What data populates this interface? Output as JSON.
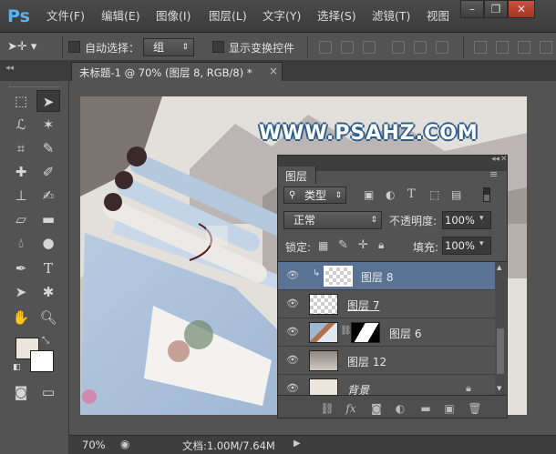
{
  "app": {
    "logo": "Ps"
  },
  "menu": [
    "文件(F)",
    "编辑(E)",
    "图像(I)",
    "图层(L)",
    "文字(Y)",
    "选择(S)",
    "滤镜(T)",
    "视图"
  ],
  "window_buttons": {
    "minimize": "–",
    "restore": "❐",
    "close": "✕"
  },
  "options": {
    "auto_select_label": "自动选择：",
    "auto_select_value": "组",
    "show_transform_label": "显示变换控件"
  },
  "document_tab": {
    "title": "未标题-1 @ 70% (图层 8, RGB/8) *",
    "close": "×"
  },
  "canvas": {
    "watermark": "WWW.PSAHZ.COM"
  },
  "layers_panel": {
    "tab": "图层",
    "filter_kind": "类型",
    "blend_mode": "正常",
    "opacity_label": "不透明度:",
    "opacity_value": "100%",
    "lock_label": "锁定:",
    "fill_label": "填充:",
    "fill_value": "100%",
    "layers": [
      {
        "name": "图层 8",
        "selected": true,
        "clipped": true
      },
      {
        "name": "图层 7",
        "selected": false
      },
      {
        "name": "图层 6",
        "selected": false,
        "has_mask": true
      },
      {
        "name": "图层 12",
        "selected": false
      },
      {
        "name": "背景",
        "selected": false,
        "locked": true
      }
    ],
    "footer_icons": [
      "link-layers-icon",
      "fx-icon",
      "add-mask-icon",
      "adjustment-layer-icon",
      "new-group-icon",
      "new-layer-icon",
      "delete-layer-icon"
    ]
  },
  "status": {
    "zoom": "70%",
    "doc_info": "文档:1.00M/7.64M"
  },
  "colors": {
    "accent": "#5ab3f0",
    "selected_row": "#5a7394",
    "panel_bg": "#535353"
  }
}
